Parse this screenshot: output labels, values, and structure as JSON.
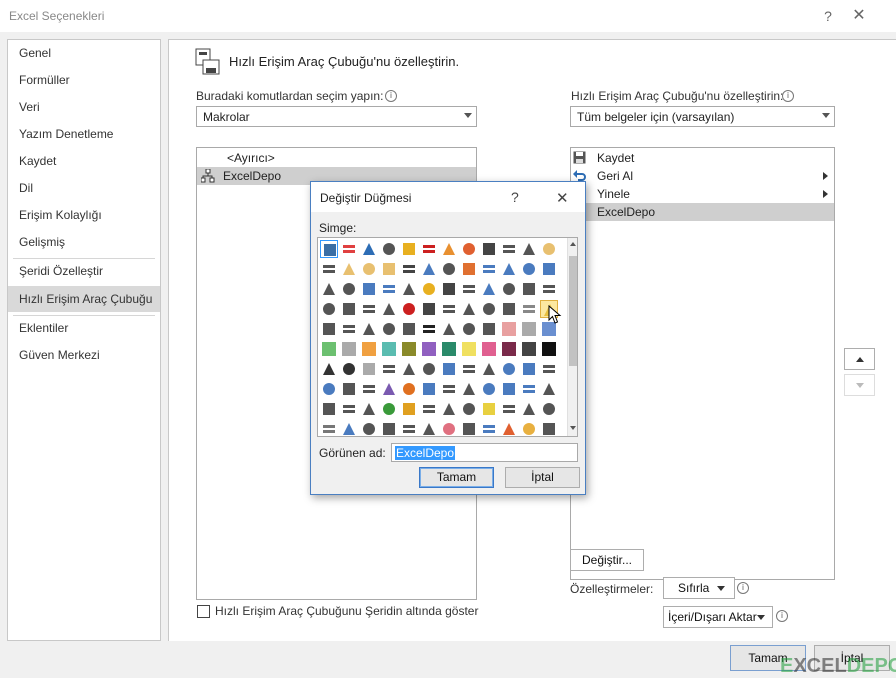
{
  "window": {
    "title": "Excel Seçenekleri",
    "help": "?",
    "close": "✕"
  },
  "nav": {
    "items": [
      {
        "label": "Genel"
      },
      {
        "label": "Formüller"
      },
      {
        "label": "Veri"
      },
      {
        "label": "Yazım Denetleme"
      },
      {
        "label": "Kaydet"
      },
      {
        "label": "Dil"
      },
      {
        "label": "Erişim Kolaylığı"
      },
      {
        "label": "Gelişmiş"
      },
      {
        "label": "Şeridi Özelleştir"
      },
      {
        "label": "Hızlı Erişim Araç Çubuğu",
        "selected": true
      },
      {
        "label": "Eklentiler"
      },
      {
        "label": "Güven Merkezi"
      }
    ]
  },
  "main": {
    "heading": "Hızlı Erişim Araç Çubuğu'nu özelleştirin.",
    "choose_label": "Buradaki komutlardan seçim yapın:",
    "choose_value": "Makrolar",
    "customize_label": "Hızlı Erişim Araç Çubuğu'nu özelleştirin:",
    "customize_value": "Tüm belgeler için (varsayılan)",
    "left_list": [
      "<Ayırıcı>",
      "ExcelDepo"
    ],
    "right_list": [
      "Kaydet",
      "Geri Al",
      "Yinele",
      "ExcelDepo"
    ],
    "modify_button": "Değiştir...",
    "customizations_label": "Özelleştirmeler:",
    "reset_button": "Sıfırla",
    "import_export_button": "İçeri/Dışarı Aktar",
    "below_ribbon_checkbox": "Hızlı Erişim Araç Çubuğunu Şeridin altında göster",
    "ok_button": "Tamam",
    "cancel_button": "İptal"
  },
  "dialog": {
    "title": "Değiştir Düğmesi",
    "help": "?",
    "close": "✕",
    "symbol_label": "Simge:",
    "display_name_label": "Görünen ad:",
    "display_name_value": "ExcelDepo",
    "ok_button": "Tamam",
    "cancel_button": "İptal",
    "icons": [
      [
        "#3a6ea5",
        "#e04040",
        "#2d6db5",
        "#555555",
        "#e8b020",
        "#cc2020",
        "#e89030",
        "#e06030",
        "#444444",
        "#555555",
        "#555555",
        "#e8c070"
      ],
      [
        "#555555",
        "#e8c070",
        "#e8c070",
        "#e8c070",
        "#444444",
        "#4a7bbf",
        "#555555",
        "#e07030",
        "#4a7bbf",
        "#4a7bbf",
        "#4a7bbf",
        "#4a7bbf"
      ],
      [
        "#555555",
        "#555555",
        "#4a7bbf",
        "#4a7bbf",
        "#555555",
        "#e8b020",
        "#444444",
        "#555555",
        "#4a7bbf",
        "#555555",
        "#555555",
        "#555555"
      ],
      [
        "#555555",
        "#555555",
        "#555555",
        "#555555",
        "#cc2020",
        "#444444",
        "#555555",
        "#555555",
        "#555555",
        "#555555",
        "#888888",
        "#e8c040"
      ],
      [
        "#555555",
        "#555555",
        "#555555",
        "#555555",
        "#555555",
        "#222222",
        "#555555",
        "#555555",
        "#555555",
        "#e8a0a0",
        "#aaaaaa",
        "#6a8fd0"
      ],
      [
        "#6cc070",
        "#aaaaaa",
        "#f0a040",
        "#5abcb0",
        "#8a8a2a",
        "#9060c0",
        "#2a8a6a",
        "#f0e060",
        "#e06090",
        "#7a2a4a",
        "#444444",
        "#111111"
      ],
      [
        "#333333",
        "#333333",
        "#aaaaaa",
        "#555555",
        "#555555",
        "#555555",
        "#4a7bbf",
        "#555555",
        "#555555",
        "#4a7bbf",
        "#4a7bbf",
        "#555555"
      ],
      [
        "#4a7bbf",
        "#555555",
        "#555555",
        "#7a5ab0",
        "#e07020",
        "#4a7bbf",
        "#555555",
        "#555555",
        "#4a7bbf",
        "#4a7bbf",
        "#4a7bbf",
        "#555555"
      ],
      [
        "#555555",
        "#555555",
        "#555555",
        "#3a9a3a",
        "#e0a020",
        "#555555",
        "#555555",
        "#555555",
        "#e8d040",
        "#555555",
        "#555555",
        "#555555"
      ],
      [
        "#777777",
        "#4a7bbf",
        "#555555",
        "#555555",
        "#555555",
        "#555555",
        "#e07080",
        "#555555",
        "#4a7bbf",
        "#e06030",
        "#e8b040",
        "#555555"
      ]
    ]
  }
}
